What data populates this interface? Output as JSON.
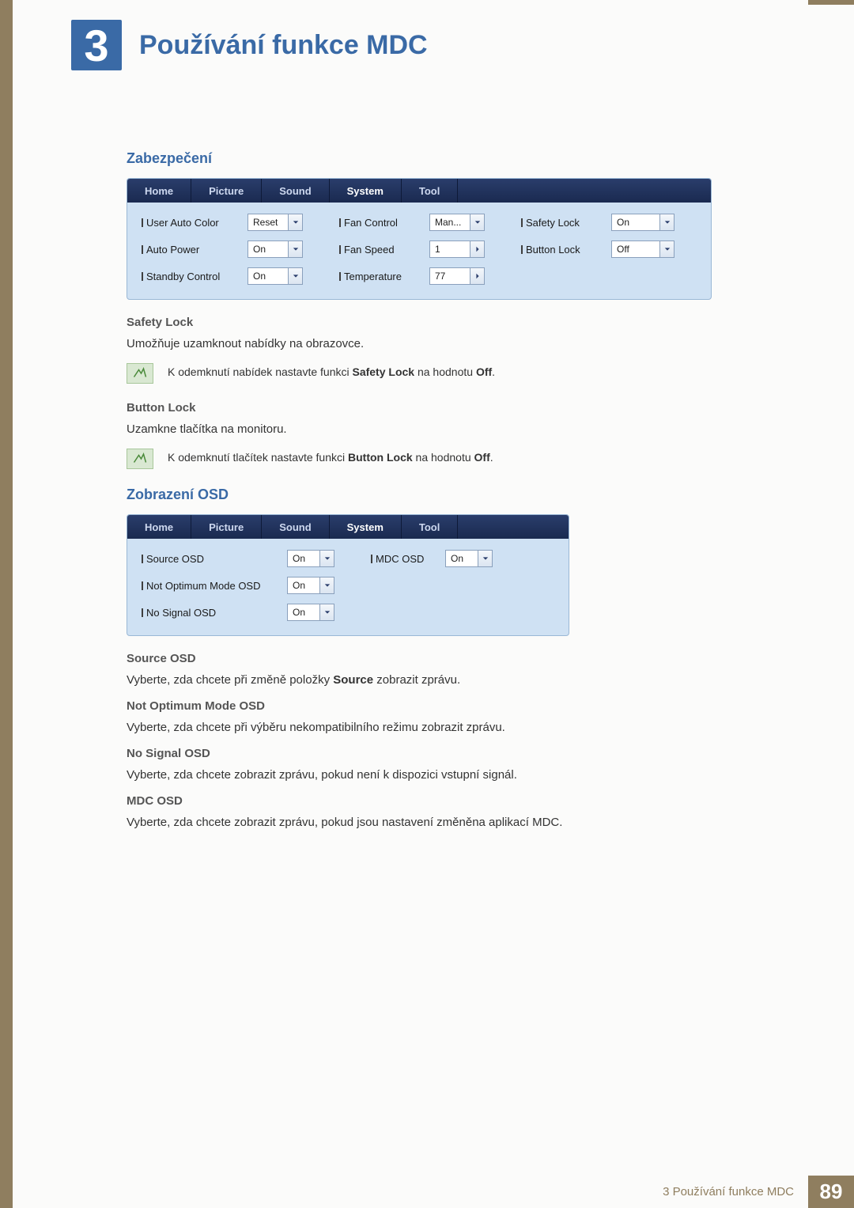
{
  "chapter": {
    "number": "3",
    "title": "Používání funkce MDC"
  },
  "sections": {
    "security": {
      "heading": "Zabezpečení",
      "tabs": [
        "Home",
        "Picture",
        "Sound",
        "System",
        "Tool"
      ],
      "activeTab": 3,
      "col1": [
        {
          "label": "User Auto Color",
          "value": "Reset",
          "type": "dropdown"
        },
        {
          "label": "Auto Power",
          "value": "On",
          "type": "dropdown"
        },
        {
          "label": "Standby Control",
          "value": "On",
          "type": "dropdown"
        }
      ],
      "col2": [
        {
          "label": "Fan Control",
          "value": "Man...",
          "type": "dropdown"
        },
        {
          "label": "Fan Speed",
          "value": "1",
          "type": "spin"
        },
        {
          "label": "Temperature",
          "value": "77",
          "type": "spin"
        }
      ],
      "col3": [
        {
          "label": "Safety Lock",
          "value": "On",
          "type": "dropdown"
        },
        {
          "label": "Button Lock",
          "value": "Off",
          "type": "dropdown"
        }
      ],
      "safetyLock": {
        "heading": "Safety Lock",
        "desc": "Umožňuje uzamknout nabídky na obrazovce.",
        "note_pre": "K odemknutí nabídek nastavte funkci ",
        "note_bold1": "Safety Lock",
        "note_mid": " na hodnotu ",
        "note_bold2": "Off",
        "note_end": "."
      },
      "buttonLock": {
        "heading": "Button Lock",
        "desc": "Uzamkne tlačítka na monitoru.",
        "note_pre": "K odemknutí tlačítek nastavte funkci ",
        "note_bold1": "Button Lock",
        "note_mid": " na hodnotu ",
        "note_bold2": "Off",
        "note_end": "."
      }
    },
    "osd": {
      "heading": "Zobrazení OSD",
      "tabs": [
        "Home",
        "Picture",
        "Sound",
        "System",
        "Tool"
      ],
      "activeTab": 3,
      "col1": [
        {
          "label": "Source OSD",
          "value": "On",
          "type": "dropdown"
        },
        {
          "label": "Not Optimum Mode OSD",
          "value": "On",
          "type": "dropdown"
        },
        {
          "label": "No Signal OSD",
          "value": "On",
          "type": "dropdown"
        }
      ],
      "col2": [
        {
          "label": "MDC OSD",
          "value": "On",
          "type": "dropdown"
        }
      ],
      "items": {
        "sourceOSD": {
          "heading": "Source OSD",
          "desc_pre": "Vyberte, zda chcete při změně položky ",
          "desc_bold": "Source",
          "desc_post": " zobrazit zprávu."
        },
        "notOptimum": {
          "heading": "Not Optimum Mode OSD",
          "desc": "Vyberte, zda chcete při výběru nekompatibilního režimu zobrazit zprávu."
        },
        "noSignal": {
          "heading": "No Signal OSD",
          "desc": "Vyberte, zda chcete zobrazit zprávu, pokud není k dispozici vstupní signál."
        },
        "mdcOSD": {
          "heading": "MDC OSD",
          "desc": "Vyberte, zda chcete zobrazit zprávu, pokud jsou nastavení změněna aplikací MDC."
        }
      }
    }
  },
  "footer": {
    "label": "3 Používání funkce MDC",
    "page": "89"
  }
}
